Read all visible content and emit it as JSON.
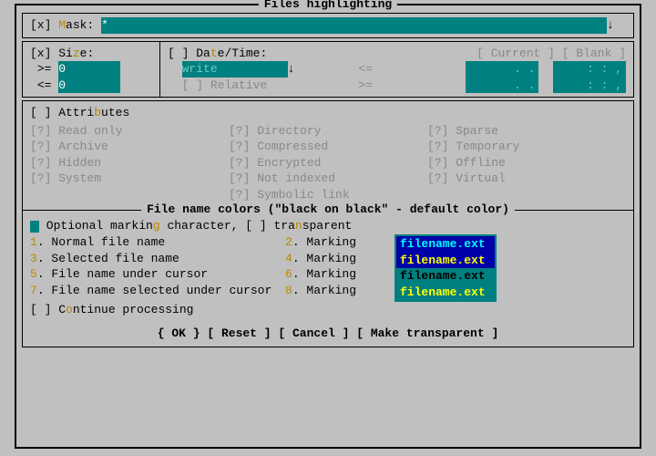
{
  "title": "Files highlighting",
  "mask": {
    "checkbox": "[x]",
    "label_pre": "M",
    "label_post": "ask:",
    "value": "*",
    "arrow": "↓"
  },
  "size": {
    "checkbox": "[x]",
    "label": "Si",
    "hot": "z",
    "label2": "e:",
    "ge": ">=",
    "le": "<=",
    "ge_val": "0",
    "le_val": "0"
  },
  "datetime": {
    "checkbox": "[ ]",
    "label_pre": "Da",
    "hot": "t",
    "label_post": "e/Time:",
    "buttons": {
      "current": "[ Current ]",
      "blank": "[ Blank ]"
    },
    "type_val": "write",
    "arrow": "↓",
    "relative": "[ ] Relative",
    "le": "<=",
    "ge": ">=",
    "date_ph": ".  .   ",
    "time_ph": ":  :  ,"
  },
  "attributes": {
    "checkbox": "[ ]",
    "label_pre": "Attri",
    "hot": "b",
    "label_post": "utes",
    "items": {
      "c1": [
        "[?] Read only",
        "[?] Archive",
        "[?] Hidden",
        "[?] System"
      ],
      "c2": [
        "[?] Directory",
        "[?] Compressed",
        "[?] Encrypted",
        "[?] Not indexed",
        "[?] Symbolic link"
      ],
      "c3": [
        "[?] Sparse",
        "[?] Temporary",
        "[?] Offline",
        "[?] Virtual"
      ]
    }
  },
  "colors": {
    "section_title": "File name colors (\"black on black\" - default color)",
    "opt_pre": " Optional markin",
    "opt_hot": "g",
    "opt_mid": " character, [ ] tra",
    "opt_hot2": "n",
    "opt_post": "sparent",
    "lines": [
      {
        "n": "1",
        "label": ". Normal file name"
      },
      {
        "n": "3",
        "label": ". Selected file name"
      },
      {
        "n": "5",
        "label": ". File name under cursor"
      },
      {
        "n": "7",
        "label": ". File name selected under cursor"
      }
    ],
    "marks": [
      {
        "n": "2",
        "label": ". Marking"
      },
      {
        "n": "4",
        "label": ". Marking"
      },
      {
        "n": "6",
        "label": ". Marking"
      },
      {
        "n": "8",
        "label": ". Marking"
      }
    ],
    "preview": [
      "filename.ext",
      "filename.ext",
      "filename.ext",
      "filename.ext"
    ],
    "continue_pre": "[ ] C",
    "continue_hot": "o",
    "continue_post": "ntinue processing"
  },
  "buttons": {
    "ok": "{ OK }",
    "reset": "[ Reset ]",
    "cancel": "[ Cancel ]",
    "transparent": "[ Make transparent ]"
  }
}
